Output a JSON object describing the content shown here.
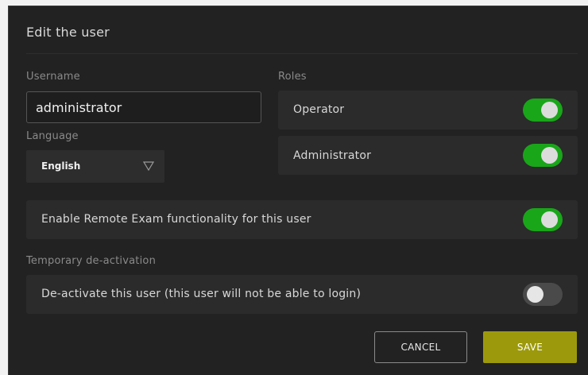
{
  "dialog": {
    "title": "Edit the user"
  },
  "username": {
    "label": "Username",
    "value": "administrator"
  },
  "language": {
    "label": "Language",
    "selected": "English"
  },
  "roles": {
    "label": "Roles",
    "items": [
      {
        "label": "Operator",
        "enabled": true
      },
      {
        "label": "Administrator",
        "enabled": true
      }
    ]
  },
  "remote_exam": {
    "label": "Enable Remote Exam functionality for this user",
    "enabled": true
  },
  "deactivation": {
    "section_label": "Temporary de-activation",
    "label": "De-activate this user (this user will not be able to login)",
    "enabled": false
  },
  "actions": {
    "cancel_label": "CANCEL",
    "save_label": "SAVE"
  },
  "colors": {
    "background": "#222222",
    "panel": "#2b2b2b",
    "toggle_on": "#19a619",
    "toggle_off": "#4a4a4a",
    "save_button": "#9c9a0c"
  },
  "icons": {
    "language_caret": "chevron-down-icon"
  }
}
